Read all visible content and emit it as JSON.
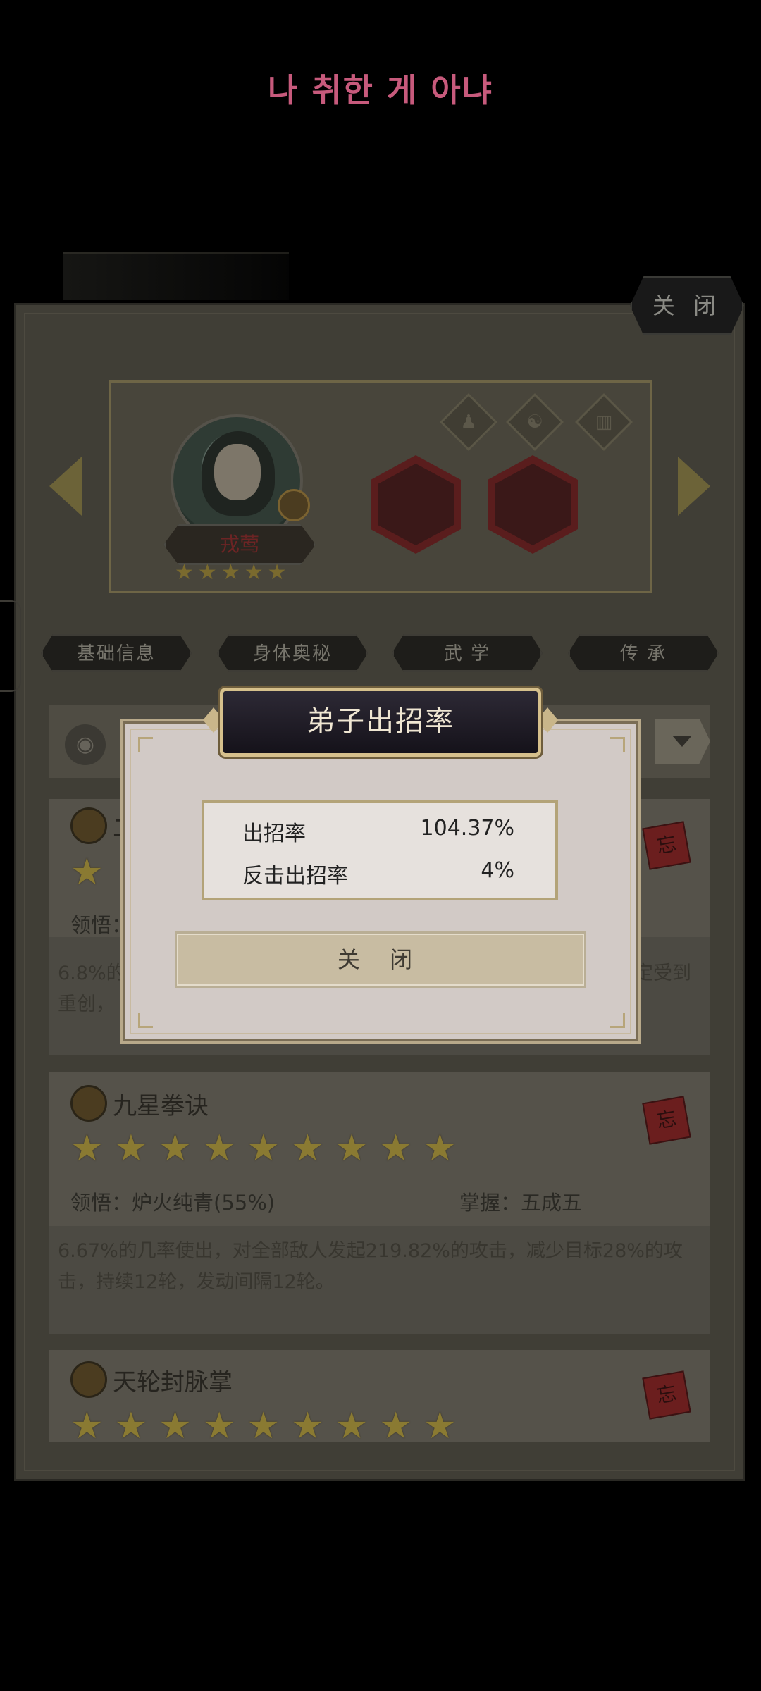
{
  "lyric_overlay": "나 취한 게 아냐",
  "top_close_label": "关 闭",
  "character": {
    "name": "戎莺",
    "stars": [
      "★",
      "★",
      "★",
      "★",
      "★"
    ]
  },
  "tabs": [
    {
      "label": "基础信息"
    },
    {
      "label": "身体奥秘"
    },
    {
      "label": "武 学"
    },
    {
      "label": "传 承"
    }
  ],
  "skills": [
    {
      "name": "九星拳诀",
      "stars": [
        "★",
        "★",
        "★",
        "★",
        "★",
        "★",
        "★",
        "★",
        "★"
      ],
      "comprehension": "领悟：炉火纯青(55%)",
      "mastery": "掌握：五成五",
      "description": "6.67%的几率使出，对全部敌人发起219.82%的攻击，减少目标28%的攻击，持续12轮，发动间隔12轮。",
      "forget_label": "忘"
    },
    {
      "name": "天轮封脉掌",
      "stars": [
        "★",
        "★",
        "★",
        "★",
        "★",
        "★",
        "★",
        "★",
        "★"
      ],
      "forget_label": "忘"
    }
  ],
  "hidden_skill": {
    "partial_name": "二",
    "stars": [
      "★"
    ],
    "comprehension": "领悟：",
    "desc_left_1": "6.8%的",
    "desc_left_2": "重创，",
    "desc_right": "定受到",
    "forget_label": "忘"
  },
  "modal": {
    "title": "弟子出招率",
    "rows": [
      {
        "label": "出招率",
        "value": "104.37%"
      },
      {
        "label": "反击出招率",
        "value": "4%"
      }
    ],
    "close_label": "关 闭"
  }
}
